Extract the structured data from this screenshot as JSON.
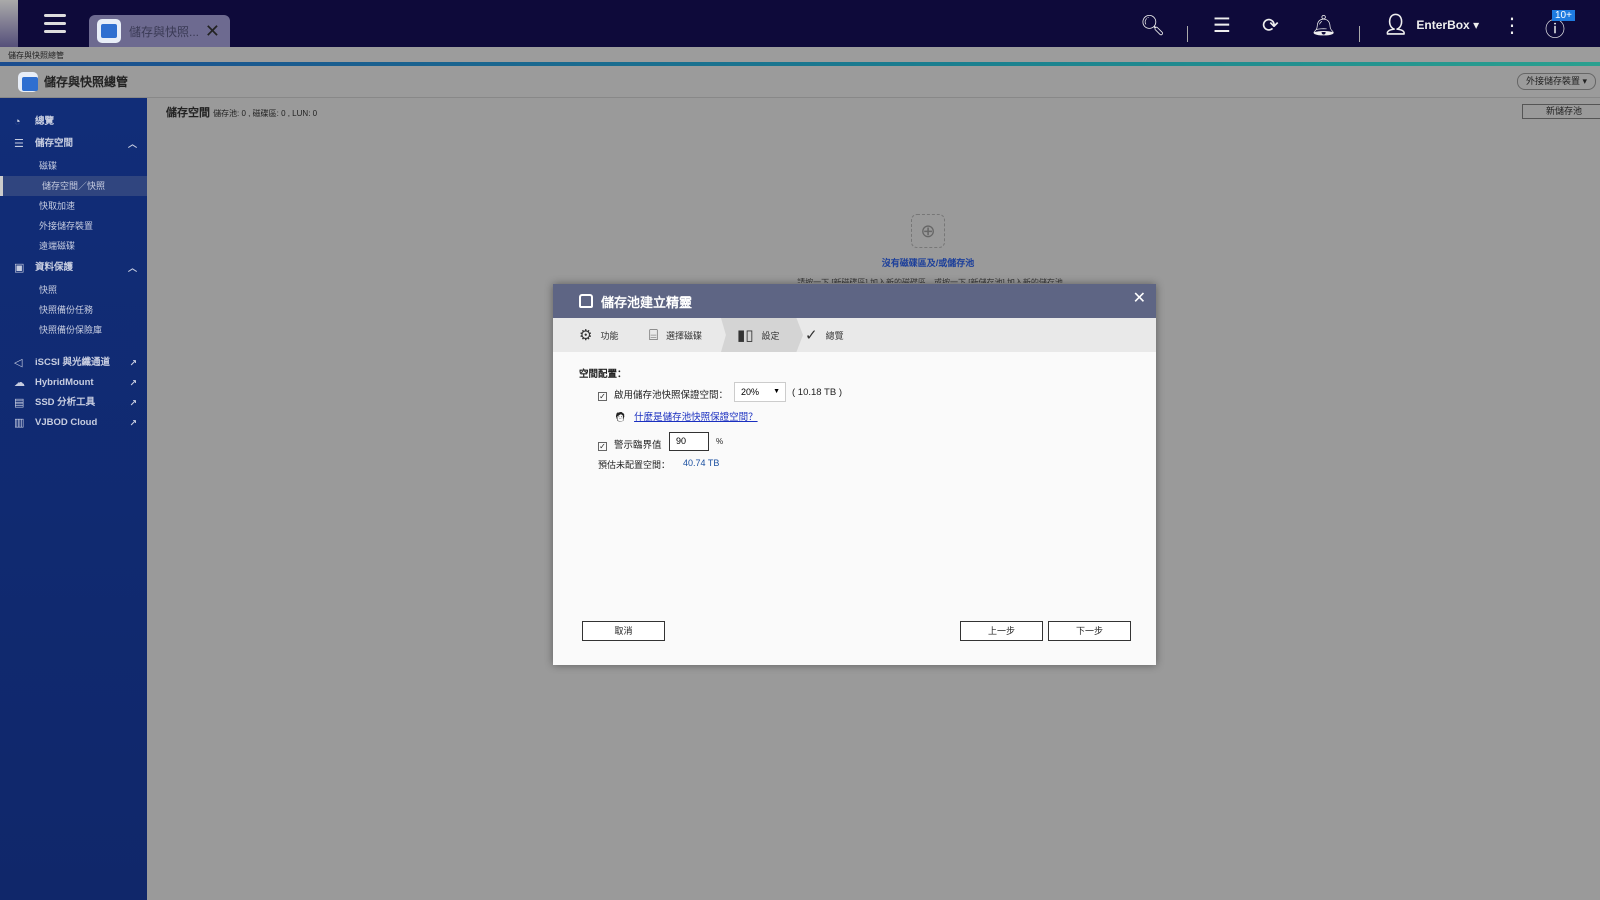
{
  "topbar": {
    "tab_title": "儲存與快照...",
    "user": "EnterBox ▾",
    "notification_badge": "10+"
  },
  "breadcrumb": "儲存與快照總管",
  "app": {
    "title": "儲存與快照總管",
    "external_device_button": "外接儲存裝置 ▾",
    "new_pool_button": "新儲存池"
  },
  "sidebar": {
    "items": [
      {
        "label": "總覽"
      },
      {
        "label": "儲存空間"
      },
      {
        "label": "磁碟"
      },
      {
        "label": "儲存空間／快照"
      },
      {
        "label": "快取加速"
      },
      {
        "label": "外接儲存裝置"
      },
      {
        "label": "遠端磁碟"
      },
      {
        "label": "資料保護"
      },
      {
        "label": "快照"
      },
      {
        "label": "快照備份任務"
      },
      {
        "label": "快照備份保險庫"
      },
      {
        "label": "iSCSI 與光纖通道"
      },
      {
        "label": "HybridMount"
      },
      {
        "label": "SSD 分析工具"
      },
      {
        "label": "VJBOD Cloud"
      }
    ]
  },
  "content": {
    "title": "儲存空間",
    "summary": "儲存池: 0 , 磁碟區: 0 , LUN: 0",
    "empty_title": "沒有磁碟區及/或儲存池",
    "empty_sub": "請按一下 [新磁碟區] 加入新的磁碟區，或按一下 [新儲存池] 加入新的儲存池"
  },
  "dialog": {
    "title": "儲存池建立精靈",
    "steps": [
      "功能",
      "選擇磁碟",
      "設定",
      "總覽"
    ],
    "section": "空間配置：",
    "snapshot_label": "啟用儲存池快照保證空間：",
    "snapshot_value": "20%",
    "snapshot_size": "( 10.18 TB )",
    "help_link": "什麼是儲存池快照保證空間？",
    "threshold_label": "警示臨界值",
    "threshold_value": "90",
    "percent": "%",
    "unalloc_label": "預估未配置空間：",
    "unalloc_value": "40.74 TB",
    "cancel": "取消",
    "back": "上一步",
    "next": "下一步"
  }
}
